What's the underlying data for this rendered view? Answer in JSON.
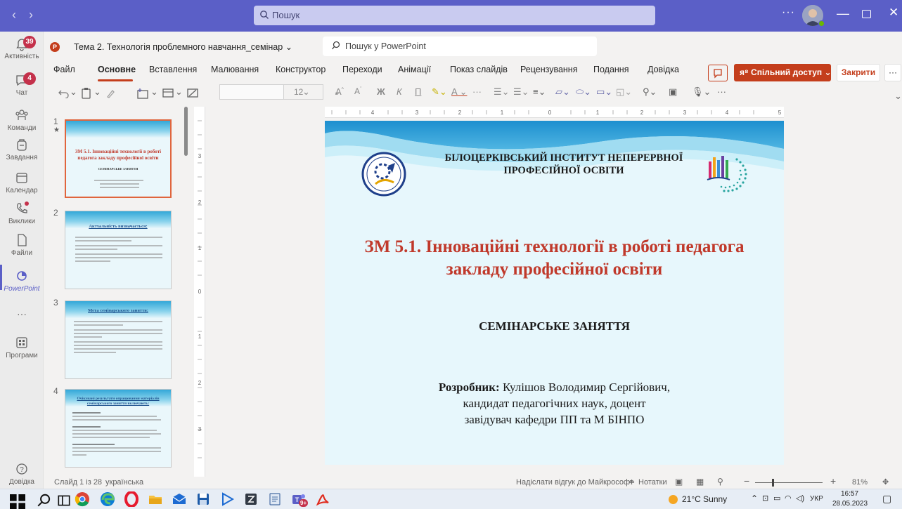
{
  "topbar": {
    "search_placeholder": "Пошук",
    "more": "···",
    "minimize": "—",
    "close": "✕"
  },
  "rail": [
    {
      "label": "Активність",
      "badge": "39"
    },
    {
      "label": "Чат",
      "badge": "4"
    },
    {
      "label": "Команди",
      "badge": ""
    },
    {
      "label": "Завдання",
      "badge": ""
    },
    {
      "label": "Календар",
      "badge": ""
    },
    {
      "label": "Виклики",
      "badge": ""
    },
    {
      "label": "Файли",
      "badge": ""
    },
    {
      "label": "PowerPoint",
      "badge": ""
    },
    {
      "label": "···",
      "badge": ""
    },
    {
      "label": "Програми",
      "badge": ""
    },
    {
      "label": "Довідка",
      "badge": ""
    }
  ],
  "app": {
    "doc_title": "Тема 2. Технологія проблемного навчання_семінар",
    "search_placeholder": "Пошук у PowerPoint",
    "share_label": "Спільний доступ",
    "close_label": "Закрити",
    "more_label": "···"
  },
  "tabs": [
    "Файл",
    "Основне",
    "Вставлення",
    "Малювання",
    "Конструктор",
    "Переходи",
    "Анімації",
    "Показ слайдів",
    "Рецензування",
    "Подання",
    "Довідка"
  ],
  "toolbar": {
    "font_size": "12",
    "more": "···"
  },
  "thumbnails": [
    {
      "number": "1",
      "title": "ЗМ 5.1. Інноваційні технології в роботі педагога закладу професійної освіти",
      "subtitle": "СЕМІНАРСЬКЕ ЗАНЯТТЯ"
    },
    {
      "number": "2",
      "title": "Актуальність визначається:"
    },
    {
      "number": "3",
      "title": "Мета семінарського заняття:"
    },
    {
      "number": "4",
      "title": "Очікувані результати опрацювання матеріалів семінарського заняття включають:"
    }
  ],
  "slide": {
    "institution": "БІЛОЦЕРКІВСЬКИЙ ІНСТИТУТ НЕПЕРЕРВНОЇ ПРОФЕСІЙНОЇ ОСВІТИ",
    "title": "ЗМ 5.1. Інноваційні технології в роботі педагога закладу професійної освіти",
    "subtitle": "СЕМІНАРСЬКЕ ЗАНЯТТЯ",
    "author_label": "Розробник:",
    "author_name": " Кулішов Володимир Сергійович,",
    "author_line2": "кандидат педагогічних наук, доцент",
    "author_line3": "завідувач кафедри ПП та М БІНПО"
  },
  "status": {
    "slide_info": "Слайд 1 із 28",
    "language": "українська",
    "feedback": "Надіслати відгук до Майкрософт",
    "notes": "Нотатки",
    "zoom": "81%"
  },
  "taskbar": {
    "weather": "21°C  Sunny",
    "lang": "УКР",
    "time": "16:57",
    "date": "28.05.2023",
    "teams_badge": "9+"
  },
  "colors": {
    "teams_brand": "#5b5fc7",
    "ppt_accent": "#c43e1c",
    "badge_red": "#c4314b",
    "slide_title_red": "#c0392b"
  }
}
